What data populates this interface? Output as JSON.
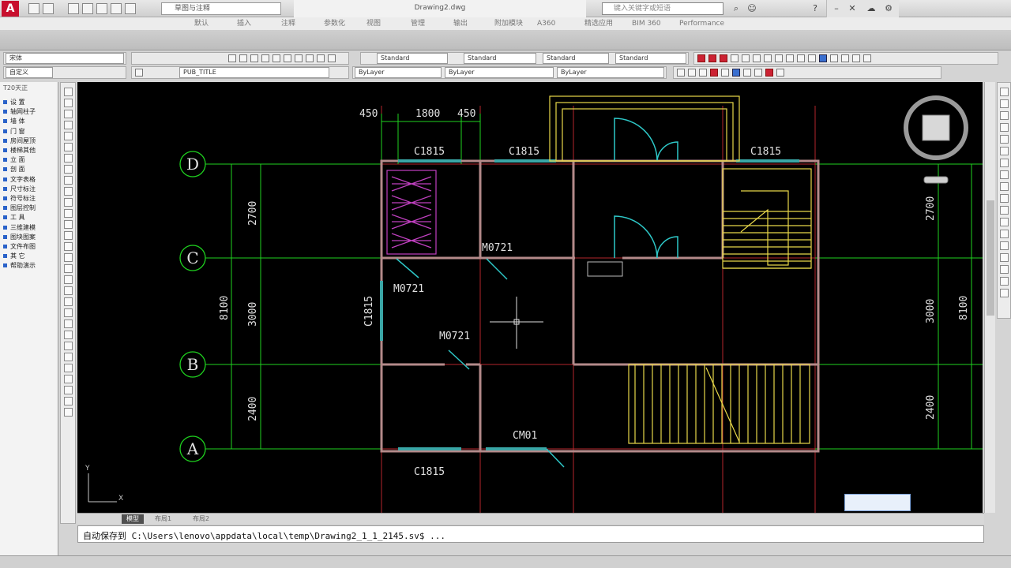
{
  "app": {
    "logo_letter": "A"
  },
  "title_bar": {
    "workspace": "草图与注释",
    "document_title": "Drawing2.dwg",
    "search_placeholder": "键入关键字或短语"
  },
  "menu": {
    "items": [
      "默认",
      "插入",
      "注释",
      "参数化",
      "视图",
      "管理",
      "输出",
      "附加模块",
      "A360",
      "精选应用",
      "BIM 360",
      "Performance"
    ]
  },
  "toolbars": {
    "style_combo": "Standard",
    "dim_style": "Standard",
    "table_style": "Standard",
    "mleader_style": "Standard",
    "layer_combo": "PUB_TITLE",
    "color_combo": "ByLayer",
    "linetype_combo": "ByLayer",
    "lineweight_combo": "ByLayer",
    "font_label": "宋体",
    "workspace_small": "自定义",
    "view_name": "自定义"
  },
  "palette": {
    "title": "T20天正",
    "items": [
      "设  置",
      "轴网柱子",
      "墙  体",
      "门  窗",
      "房间屋顶",
      "楼梯其他",
      "立  面",
      "剖  面",
      "文字表格",
      "尺寸标注",
      "符号标注",
      "图层控制",
      "工  具",
      "三维建模",
      "图块图案",
      "文件布图",
      "其  它",
      "帮助演示"
    ]
  },
  "drawing": {
    "axis_rows": [
      "D",
      "C",
      "B",
      "A"
    ],
    "top_dims": [
      "450",
      "1800",
      "450"
    ],
    "left_dims_small": [
      "2700",
      "3000",
      "2400"
    ],
    "left_dim_total": "8100",
    "right_dims_small": [
      "2700",
      "3000",
      "2400"
    ],
    "right_dim_total": "8100",
    "window_labels_top": [
      "C1815",
      "C1815",
      "C1815"
    ],
    "window_label_bottom": "C1815",
    "window_label_left": "C1815",
    "door_labels": [
      "M0721",
      "M0721",
      "M0721"
    ],
    "door_label_cm": "CM01",
    "ucs_x": "X",
    "ucs_y": "Y"
  },
  "tabs": [
    "模型",
    "布局1",
    "布局2"
  ],
  "command_line": {
    "prompt": "自动保存到",
    "path": "C:\\Users\\lenovo\\appdata\\local\\temp\\Drawing2_1_1_2145.sv$ ..."
  },
  "colors": {
    "canvas": "#000000",
    "grid_red": "#b3262b",
    "grid_green": "#1fd21f",
    "wall": "#b48a8a",
    "window": "#3aa6a6",
    "door": "#2ec8c8",
    "stair": "#e8d84a",
    "furniture": "#c040c0",
    "text": "#e0e0e0"
  }
}
